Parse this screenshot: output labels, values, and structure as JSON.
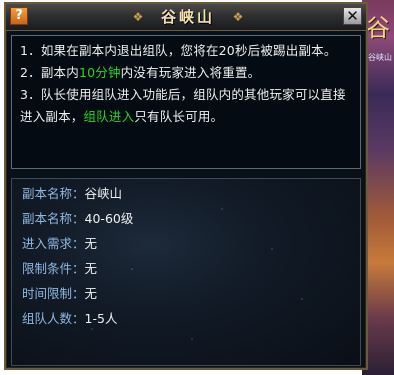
{
  "dialog": {
    "title": "谷峡山",
    "help_label": "?",
    "close_label": "✕"
  },
  "rules": [
    {
      "text_before": "1．如果在副本内退出组队，您将在20秒后被踢出副本。",
      "highlight": "",
      "text_after": ""
    },
    {
      "text_before": "2．副本内",
      "highlight": "10分钟",
      "text_after": "内没有玩家进入将重置。"
    },
    {
      "text_before": "3．队长使用组队进入功能后，组队内的其他玩家可以直接进入副本，",
      "highlight": "组队进入",
      "text_after": "只有队长可用。"
    }
  ],
  "info": [
    {
      "label": "副本名称",
      "value": "谷峡山"
    },
    {
      "label": "副本名称",
      "value": "40-60级"
    },
    {
      "label": "进入需求",
      "value": "无"
    },
    {
      "label": "限制条件",
      "value": "无"
    },
    {
      "label": "时间限制",
      "value": "无"
    },
    {
      "label": "组队人数",
      "value": "1-5人"
    }
  ],
  "background": {
    "side_glyph": "谷",
    "side_text": "谷峡山"
  },
  "colors": {
    "highlight_green": "#28d628",
    "label_blue": "#8fb8e0",
    "frame_gold": "#6d5a3a"
  }
}
